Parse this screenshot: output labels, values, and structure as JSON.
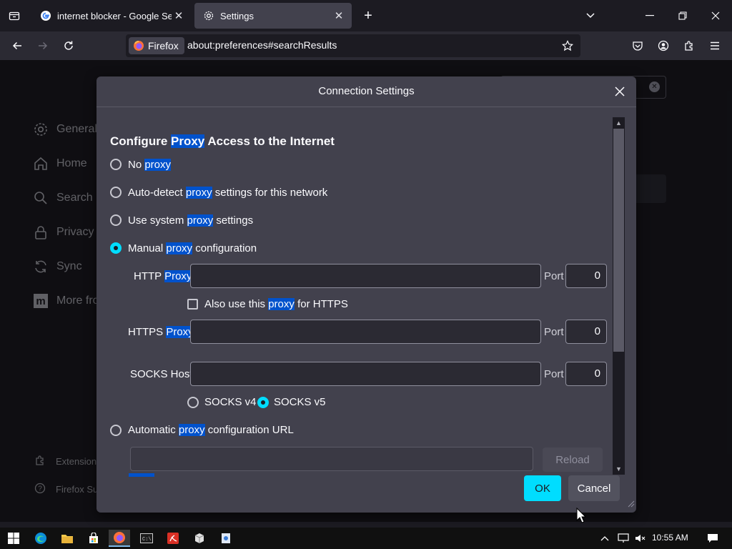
{
  "tabs": [
    {
      "title": "internet blocker - Google Search",
      "favicon": "google-icon",
      "active": false
    },
    {
      "title": "Settings",
      "favicon": "gear-icon",
      "active": true
    }
  ],
  "navbar": {
    "identity_label": "Firefox",
    "url": "about:preferences#searchResults"
  },
  "sidebar": {
    "categories": [
      {
        "label": "General",
        "icon": "gear-icon"
      },
      {
        "label": "Home",
        "icon": "home-icon"
      },
      {
        "label": "Search",
        "icon": "search-icon"
      },
      {
        "label": "Privacy &",
        "icon": "lock-icon"
      },
      {
        "label": "Sync",
        "icon": "sync-icon"
      },
      {
        "label": "More fro",
        "icon": "mozilla-icon"
      }
    ],
    "footer": [
      {
        "label": "Extension",
        "icon": "puzzle-icon"
      },
      {
        "label": "Firefox Su",
        "icon": "help-icon"
      }
    ]
  },
  "dialog": {
    "title": "Connection Settings",
    "heading_pre": "Configure ",
    "heading_hl": "Proxy",
    "heading_post": " Access to the Internet",
    "hl_word": "proxy",
    "options": {
      "no_proxy": {
        "pre": "No ",
        "post": ""
      },
      "auto_detect": {
        "pre": "Auto-detect ",
        "post": " settings for this network"
      },
      "system": {
        "pre": "Use system ",
        "post": " settings"
      },
      "manual": {
        "pre": "Manual ",
        "post": " configuration"
      },
      "auto_url": {
        "pre": "Automatic ",
        "post": " configuration URL"
      }
    },
    "http_proxy_label": "HTTP",
    "http_proxy_hl": "Proxy",
    "https_proxy_label": "HTTPS",
    "https_proxy_hl": "Proxy",
    "socks_host_label": "SOCKS Host",
    "port_label": "Port",
    "http_port": "0",
    "https_port": "0",
    "socks_port": "0",
    "also_https_pre": "Also use this ",
    "also_https_post": " for HTTPS",
    "socks_v4": "SOCKS v4",
    "socks_v5": "SOCKS v5",
    "reload_label": "Reload",
    "ok_label": "OK",
    "cancel_label": "Cancel"
  },
  "taskbar": {
    "clock": "10:55 AM"
  },
  "colors": {
    "accent": "#00ddff",
    "highlight": "#0052cc",
    "dialog_bg": "#42414d",
    "page_bg": "#1c1b22"
  }
}
